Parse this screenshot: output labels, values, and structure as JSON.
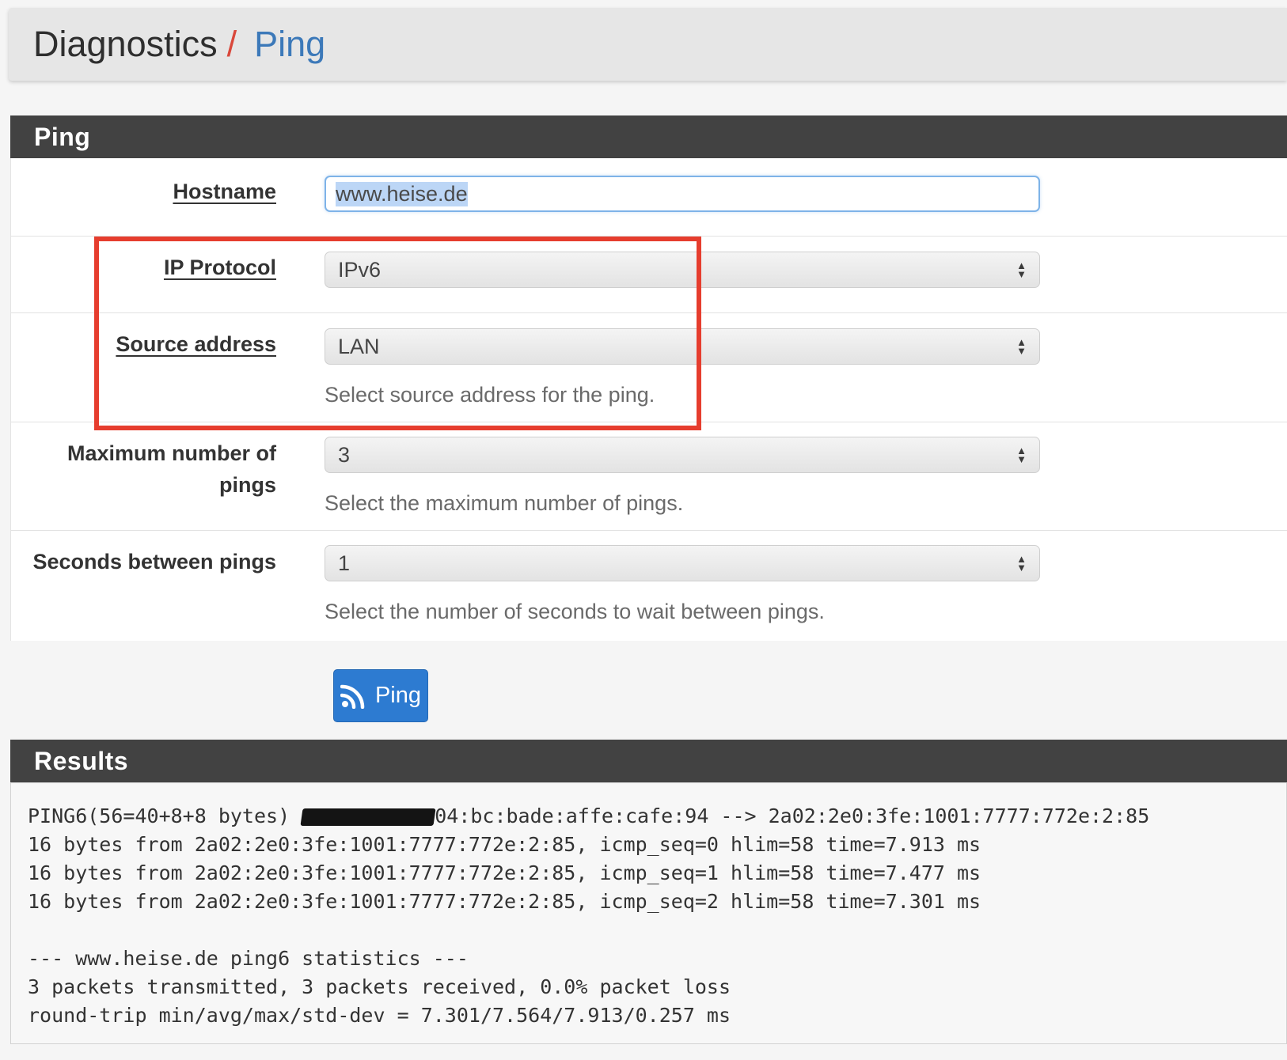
{
  "breadcrumb": {
    "section": "Diagnostics",
    "separator": "/",
    "current": "Ping"
  },
  "ping_panel": {
    "title": "Ping",
    "fields": {
      "hostname": {
        "label": "Hostname",
        "value": "www.heise.de"
      },
      "ip_protocol": {
        "label": "IP Protocol",
        "selected": "IPv6"
      },
      "source_address": {
        "label": "Source address",
        "selected": "LAN",
        "help": "Select source address for the ping."
      },
      "max_pings": {
        "label_line1": "Maximum number of",
        "label_line2": "pings",
        "selected": "3",
        "help": "Select the maximum number of pings."
      },
      "seconds_between": {
        "label": "Seconds between pings",
        "selected": "1",
        "help": "Select the number of seconds to wait between pings."
      }
    },
    "submit_label": "Ping"
  },
  "results_panel": {
    "title": "Results",
    "first_line_prefix": "PING6(56=40+8+8 bytes) ",
    "first_line_suffix": "04:bc:bade:affe:cafe:94 --> 2a02:2e0:3fe:1001:7777:772e:2:85",
    "lines": [
      "16 bytes from 2a02:2e0:3fe:1001:7777:772e:2:85, icmp_seq=0 hlim=58 time=7.913 ms",
      "16 bytes from 2a02:2e0:3fe:1001:7777:772e:2:85, icmp_seq=1 hlim=58 time=7.477 ms",
      "16 bytes from 2a02:2e0:3fe:1001:7777:772e:2:85, icmp_seq=2 hlim=58 time=7.301 ms",
      "",
      "--- www.heise.de ping6 statistics ---",
      "3 packets transmitted, 3 packets received, 0.0% packet loss",
      "round-trip min/avg/max/std-dev = 7.301/7.564/7.913/0.257 ms"
    ]
  },
  "colors": {
    "panel_heading": "#424242",
    "link_blue": "#3c79b9",
    "separator_red": "#d9483b",
    "highlight_red": "#e63d2e",
    "button_blue": "#2d7bd1"
  },
  "icons": {
    "select_arrows": "up-down-arrows-icon",
    "ping_button": "rss-icon"
  }
}
